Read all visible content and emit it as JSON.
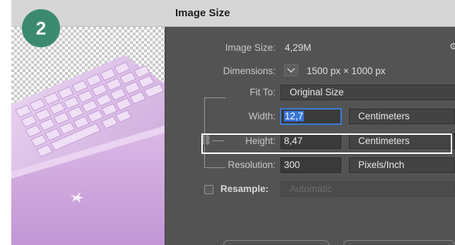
{
  "step_badge": "2",
  "dialog": {
    "title": "Image Size"
  },
  "image_size": {
    "label": "Image Size:",
    "value": "4,29M"
  },
  "dimensions": {
    "label": "Dimensions:",
    "value": "1500 px  ×  1000 px"
  },
  "fit_to": {
    "label": "Fit To:",
    "value": "Original Size"
  },
  "width": {
    "label": "Width:",
    "value": "12,7",
    "unit": "Centimeters"
  },
  "height": {
    "label": "Height:",
    "value": "8,47",
    "unit": "Centimeters"
  },
  "resolution": {
    "label": "Resolution:",
    "value": "300",
    "unit": "Pixels/Inch"
  },
  "resample": {
    "label": "Resample:",
    "value": "Automatic",
    "checked": false
  },
  "colors": {
    "badge": "#3b8a6f",
    "dialog_bg": "#535353",
    "keyboard": "#d9b8e6",
    "selection": "#3874d8",
    "highlight": "#ffffff"
  },
  "icons": {
    "chain": "link-icon",
    "gear": "gear-icon",
    "chevron": "chevron-down-icon",
    "logo": "razer-logo-icon"
  }
}
